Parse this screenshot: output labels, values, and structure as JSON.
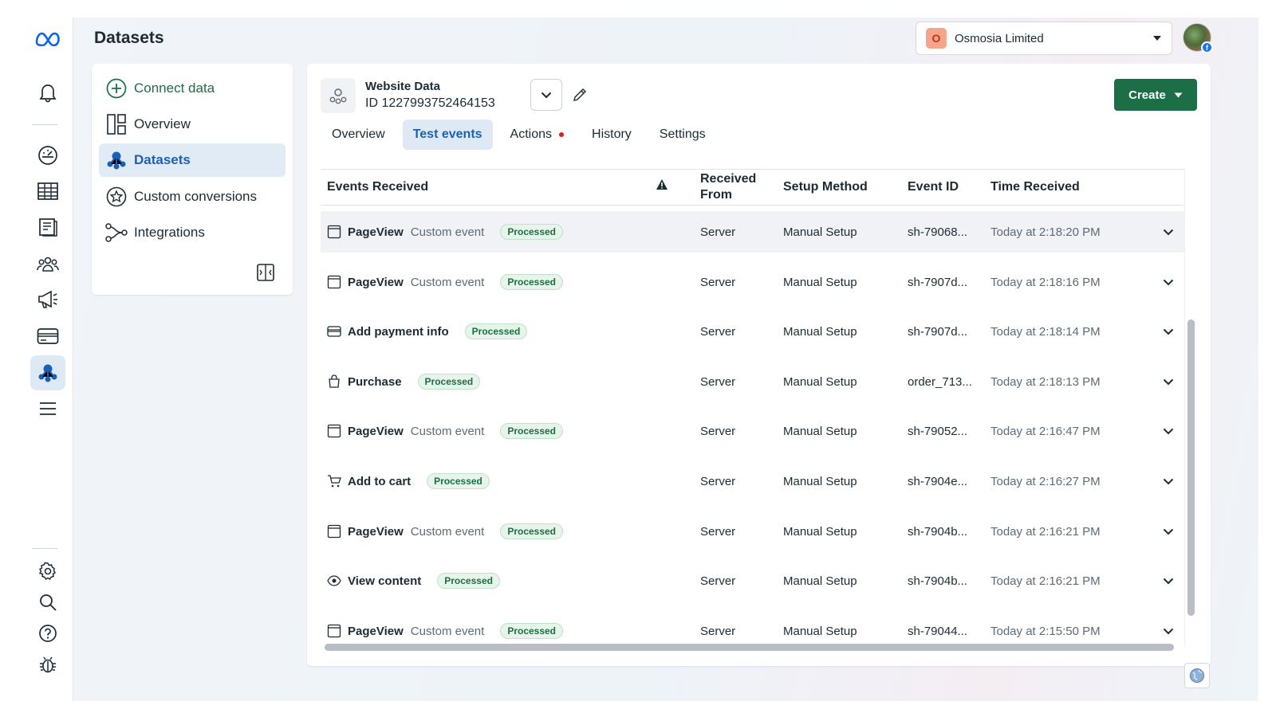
{
  "header": {
    "title": "Datasets"
  },
  "account": {
    "badge": "O",
    "name": "Osmosia Limited"
  },
  "avatar_badge": "f",
  "nav_rail": [
    "meta-logo-icon",
    "notifications-icon",
    "dashboard-icon",
    "table-icon",
    "pages-icon",
    "audiences-icon",
    "ads-icon",
    "billing-icon",
    "events-manager-icon",
    "menu-icon",
    "settings-icon",
    "search-icon",
    "help-icon",
    "bug-icon"
  ],
  "sidebar": {
    "items": [
      {
        "label": "Connect data"
      },
      {
        "label": "Overview"
      },
      {
        "label": "Datasets"
      },
      {
        "label": "Custom conversions"
      },
      {
        "label": "Integrations"
      }
    ]
  },
  "dataset": {
    "name": "Website Data",
    "id_label": "ID 1227993752464153"
  },
  "create_button": "Create",
  "tabs": [
    {
      "label": "Overview"
    },
    {
      "label": "Test events"
    },
    {
      "label": "Actions"
    },
    {
      "label": "History"
    },
    {
      "label": "Settings"
    }
  ],
  "table": {
    "columns": {
      "events": "Events Received",
      "from_1": "Received",
      "from_2": "From",
      "setup": "Setup Method",
      "event_id": "Event ID",
      "time": "Time Received"
    },
    "rows": [
      {
        "icon": "page-icon",
        "name": "PageView",
        "sub": "Custom event",
        "status": "Processed",
        "from": "Server",
        "setup": "Manual Setup",
        "event_id": "sh-79068...",
        "time": "Today at 2:18:20 PM"
      },
      {
        "icon": "page-icon",
        "name": "PageView",
        "sub": "Custom event",
        "status": "Processed",
        "from": "Server",
        "setup": "Manual Setup",
        "event_id": "sh-7907d...",
        "time": "Today at 2:18:16 PM"
      },
      {
        "icon": "card-icon",
        "name": "Add payment info",
        "sub": "",
        "status": "Processed",
        "from": "Server",
        "setup": "Manual Setup",
        "event_id": "sh-7907d...",
        "time": "Today at 2:18:14 PM"
      },
      {
        "icon": "bag-icon",
        "name": "Purchase",
        "sub": "",
        "status": "Processed",
        "from": "Server",
        "setup": "Manual Setup",
        "event_id": "order_713...",
        "time": "Today at 2:18:13 PM"
      },
      {
        "icon": "page-icon",
        "name": "PageView",
        "sub": "Custom event",
        "status": "Processed",
        "from": "Server",
        "setup": "Manual Setup",
        "event_id": "sh-79052...",
        "time": "Today at 2:16:47 PM"
      },
      {
        "icon": "cart-icon",
        "name": "Add to cart",
        "sub": "",
        "status": "Processed",
        "from": "Server",
        "setup": "Manual Setup",
        "event_id": "sh-7904e...",
        "time": "Today at 2:16:27 PM"
      },
      {
        "icon": "page-icon",
        "name": "PageView",
        "sub": "Custom event",
        "status": "Processed",
        "from": "Server",
        "setup": "Manual Setup",
        "event_id": "sh-7904b...",
        "time": "Today at 2:16:21 PM"
      },
      {
        "icon": "eye-icon",
        "name": "View content",
        "sub": "",
        "status": "Processed",
        "from": "Server",
        "setup": "Manual Setup",
        "event_id": "sh-7904b...",
        "time": "Today at 2:16:21 PM"
      },
      {
        "icon": "page-icon",
        "name": "PageView",
        "sub": "Custom event",
        "status": "Processed",
        "from": "Server",
        "setup": "Manual Setup",
        "event_id": "sh-79044...",
        "time": "Today at 2:15:50 PM"
      }
    ]
  },
  "colors": {
    "accent_green": "#1b6e46",
    "link_blue": "#1a61b5",
    "badge_bg": "#e6f4e9",
    "alert_red": "#d62020"
  }
}
